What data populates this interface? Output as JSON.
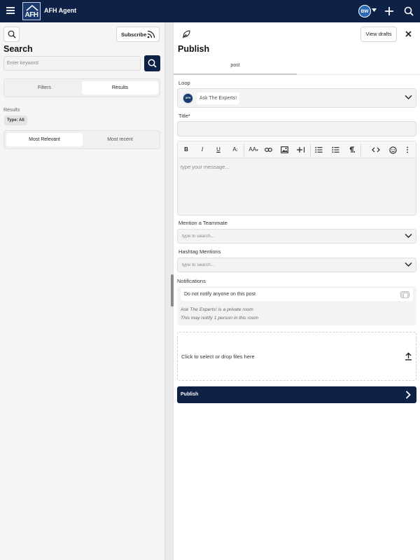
{
  "app": {
    "title": "AFH Agent",
    "logo_text": "AFH",
    "user_initials": "BW"
  },
  "icons": {
    "menu": "hamburger-menu-icon",
    "search": "search-icon",
    "add": "plus-icon",
    "rss": "rss-icon",
    "feather": "feather-icon",
    "close": "close-icon",
    "chevron": "chevron-down-icon",
    "upload": "upload-icon",
    "arrow": "chevron-right-icon"
  },
  "colors": {
    "brand": "#0d2246",
    "avatar": "#2a6ab5"
  },
  "search_panel": {
    "subscribe_label": "Subscribe",
    "title": "Search",
    "keyword_placeholder": "Enter keyword",
    "tabs": {
      "filters": "Filters",
      "results": "Results",
      "active": "results"
    },
    "results_label": "Results",
    "type_chip": "Type: All",
    "sort": {
      "relevant": "Most Relevant",
      "recent": "Most recent",
      "active": "relevant"
    }
  },
  "publish_panel": {
    "view_drafts_label": "View drafts",
    "title": "Publish",
    "tab_post": "post",
    "loop_label": "Loop",
    "loop_value": "Ask The Experts!",
    "loop_avatar_text": "AFH",
    "title_label": "Title*",
    "title_value": "",
    "editor_placeholder": "type your message...",
    "toolbar": {
      "bold": "B",
      "italic": "I",
      "underline": "U",
      "text_size": "A",
      "font_size": "AA"
    },
    "mention_label": "Mention a Teammate",
    "mention_placeholder": "type to search...",
    "hashtag_label": "Hashtag Mentions",
    "hashtag_placeholder": "type to search...",
    "notifications_label": "Notifications",
    "do_not_notify_label": "Do not notify anyone on this post",
    "do_not_notify_on": false,
    "private_note": "Ask The Experts! is a private room",
    "notify_note": "This may notify 1 person in this room",
    "dropzone_label": "Click to select or drop files here",
    "publish_button": "Publish"
  }
}
